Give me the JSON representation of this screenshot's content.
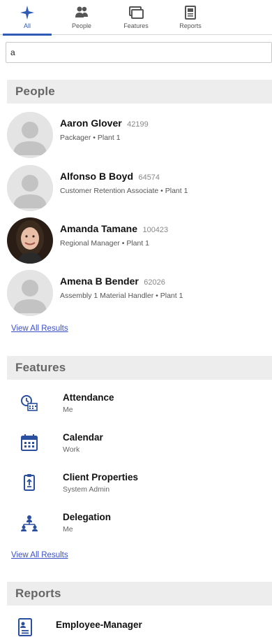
{
  "tabs": [
    {
      "label": "All",
      "icon": "sparkle-icon",
      "active": true
    },
    {
      "label": "People",
      "icon": "people-icon",
      "active": false
    },
    {
      "label": "Features",
      "icon": "features-icon",
      "active": false
    },
    {
      "label": "Reports",
      "icon": "reports-icon",
      "active": false
    }
  ],
  "search": {
    "value": "a",
    "placeholder": ""
  },
  "people_section": {
    "title": "People",
    "items": [
      {
        "name": "Aaron Glover",
        "id": "42199",
        "subtitle": "Packager  •  Plant 1",
        "avatar": "placeholder"
      },
      {
        "name": "Alfonso B Boyd",
        "id": "64574",
        "subtitle": "Customer Retention Associate  •  Plant 1",
        "avatar": "placeholder"
      },
      {
        "name": "Amanda Tamane",
        "id": "100423",
        "subtitle": "Regional Manager  •  Plant 1",
        "avatar": "photo"
      },
      {
        "name": "Amena B Bender",
        "id": "62026",
        "subtitle": "Assembly 1 Material Handler  •  Plant 1",
        "avatar": "placeholder"
      }
    ],
    "view_all": "View All Results"
  },
  "features_section": {
    "title": "Features",
    "items": [
      {
        "title": "Attendance",
        "subtitle": "Me",
        "icon": "attendance-icon"
      },
      {
        "title": "Calendar",
        "subtitle": "Work",
        "icon": "calendar-icon"
      },
      {
        "title": "Client Properties",
        "subtitle": "System Admin",
        "icon": "clipboard-icon"
      },
      {
        "title": "Delegation",
        "subtitle": "Me",
        "icon": "delegation-icon"
      }
    ],
    "view_all": "View All Results"
  },
  "reports_section": {
    "title": "Reports",
    "items": [
      {
        "title": "Employee-Manager",
        "icon": "report-icon"
      }
    ]
  },
  "colors": {
    "accent": "#2f5bb7",
    "link": "#3a4fc7",
    "header_bg": "#ededed",
    "icon_blue": "#2a4f9e"
  }
}
